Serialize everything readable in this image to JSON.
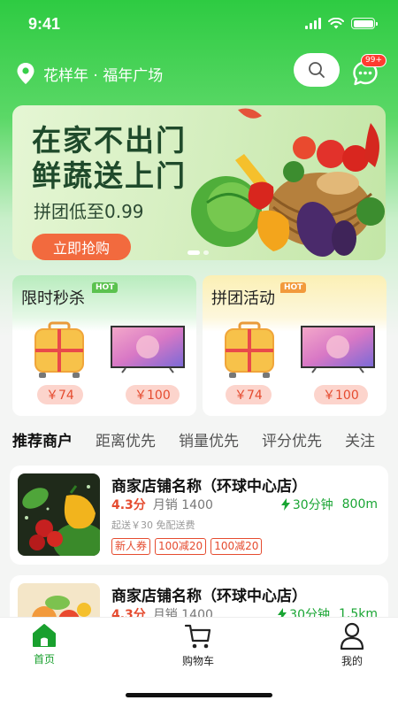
{
  "status": {
    "time": "9:41"
  },
  "header": {
    "location": "花样年 · 福年广场",
    "message_badge": "99+"
  },
  "banner": {
    "title_line1": "在家不出门",
    "title_line2": "鲜蔬送上门",
    "subtitle": "拼团低至0.99",
    "button": "立即抢购"
  },
  "promos": [
    {
      "title": "限时秒杀",
      "badge": "HOT",
      "items": [
        {
          "price": "￥74"
        },
        {
          "price": "￥100"
        }
      ]
    },
    {
      "title": "拼团活动",
      "badge": "HOT",
      "items": [
        {
          "price": "￥74"
        },
        {
          "price": "￥100"
        }
      ]
    }
  ],
  "tabs": [
    "推荐商户",
    "距离优先",
    "销量优先",
    "评分优先",
    "关注"
  ],
  "shops": [
    {
      "name": "商家店铺名称（环球中心店）",
      "rating": "4.3分",
      "sales": "月销 1400",
      "time": "30分钟",
      "distance": "800m",
      "fees": "起送￥30 免配送费",
      "coupons": [
        "新人券",
        "100减20",
        "100减20"
      ]
    },
    {
      "name": "商家店铺名称（环球中心店）",
      "rating": "4.3分",
      "sales": "月销 1400",
      "time": "30分钟",
      "distance": "1.5km"
    }
  ],
  "nav": {
    "home": "首页",
    "cart": "购物车",
    "mine": "我的"
  },
  "colors": {
    "brand_green": "#2ecb42",
    "price_red": "#e54b2f",
    "active_green": "#19a02e"
  }
}
